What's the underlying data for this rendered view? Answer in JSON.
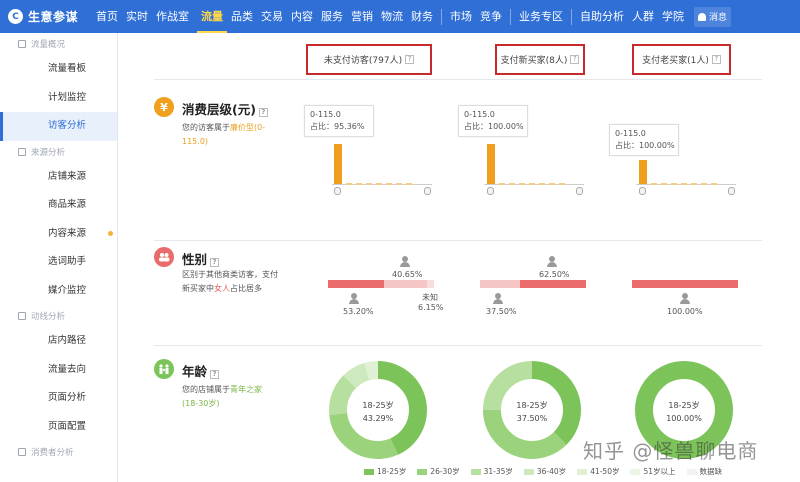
{
  "header": {
    "logo_text": "生意参谋",
    "logo_glyph": "C",
    "nav": [
      {
        "label": "首页"
      },
      {
        "label": "实时"
      },
      {
        "label": "作战室"
      },
      {
        "label": "流量",
        "active": true
      },
      {
        "label": "品类"
      },
      {
        "label": "交易"
      },
      {
        "label": "内容"
      },
      {
        "label": "服务"
      },
      {
        "label": "营销"
      },
      {
        "label": "物流"
      },
      {
        "label": "财务"
      }
    ],
    "nav2": [
      {
        "label": "市场"
      },
      {
        "label": "竞争"
      }
    ],
    "nav3": [
      {
        "label": "业务专区"
      }
    ],
    "nav4": [
      {
        "label": "自助分析"
      },
      {
        "label": "人群"
      },
      {
        "label": "学院"
      }
    ],
    "message_label": "消息",
    "accent": "#2f6fd6"
  },
  "sidebar": {
    "groups": [
      {
        "label": "流量概况",
        "items": [
          "流量看板",
          "计划监控",
          "访客分析"
        ]
      },
      {
        "label": "来源分析",
        "items": [
          "店铺来源",
          "商品来源",
          "内容来源",
          "选词助手",
          "媒介监控"
        ]
      },
      {
        "label": "动线分析",
        "items": [
          "店内路径",
          "流量去向",
          "页面分析",
          "页面配置"
        ]
      },
      {
        "label": "消费者分析",
        "items": []
      }
    ],
    "active_item": "访客分析"
  },
  "columns": [
    {
      "label": "未支付访客(797人)"
    },
    {
      "label": "支付新买家(8人)"
    },
    {
      "label": "支付老买家(1人)"
    }
  ],
  "help_glyph": "?",
  "consumption": {
    "title": "消费层级(元)",
    "icon_glyph": "¥",
    "desc_prefix": "您的访客属于",
    "desc_highlight": "廉价型(0-115.0)",
    "tooltips": [
      {
        "range": "0-115.0",
        "ratio": "占比：95.36%",
        "value": 95.36
      },
      {
        "range": "0-115.0",
        "ratio": "占比：100.00%",
        "value": 100.0
      },
      {
        "range": "0-115.0",
        "ratio": "占比：100.00%",
        "value": 100.0
      }
    ],
    "color": "#f0a01e"
  },
  "gender": {
    "title": "性别",
    "desc_line1": "区别于其他商类访客，支付",
    "desc_line2_prefix": "新买家中",
    "desc_highlight": "女人",
    "desc_line2_suffix": "占比居多",
    "columns": [
      {
        "female": "53.20%",
        "male": "40.65%",
        "unknown_label": "未知",
        "unknown": "6.15%",
        "female_frac": 0.532,
        "male_frac": 0.4065,
        "unknown_frac": 0.0615
      },
      {
        "female": "37.50%",
        "male": "62.50%",
        "female_frac": 0.375,
        "male_frac": 0.625
      },
      {
        "female": "100.00%",
        "female_frac": 1.0
      }
    ],
    "female_color": "#e96b6b",
    "male_light_color": "#f6c6c6"
  },
  "age": {
    "title": "年龄",
    "desc_prefix": "您的店铺属于",
    "desc_highlight": "青年之家(18-30岁)",
    "donuts": [
      {
        "label": "18-25岁",
        "value": "43.29%",
        "segments": [
          0.4329,
          0.3,
          0.14,
          0.08,
          0.0471
        ]
      },
      {
        "label": "18-25岁",
        "value": "37.50%",
        "segments": [
          0.375,
          0.375,
          0.25
        ]
      },
      {
        "label": "18-25岁",
        "value": "100.00%",
        "segments": [
          1.0
        ]
      }
    ],
    "legend": [
      {
        "label": "18-25岁",
        "color": "#7cc45a"
      },
      {
        "label": "26-30岁",
        "color": "#9bd27c"
      },
      {
        "label": "31-35岁",
        "color": "#b7dfa0"
      },
      {
        "label": "36-40岁",
        "color": "#cde9bd"
      },
      {
        "label": "41-50岁",
        "color": "#dff0d4"
      },
      {
        "label": "51岁以上",
        "color": "#edf6e6"
      },
      {
        "label": "数据缺",
        "color": "#f3f3f3"
      }
    ]
  },
  "watermark": "知乎 @怪兽聊电商"
}
